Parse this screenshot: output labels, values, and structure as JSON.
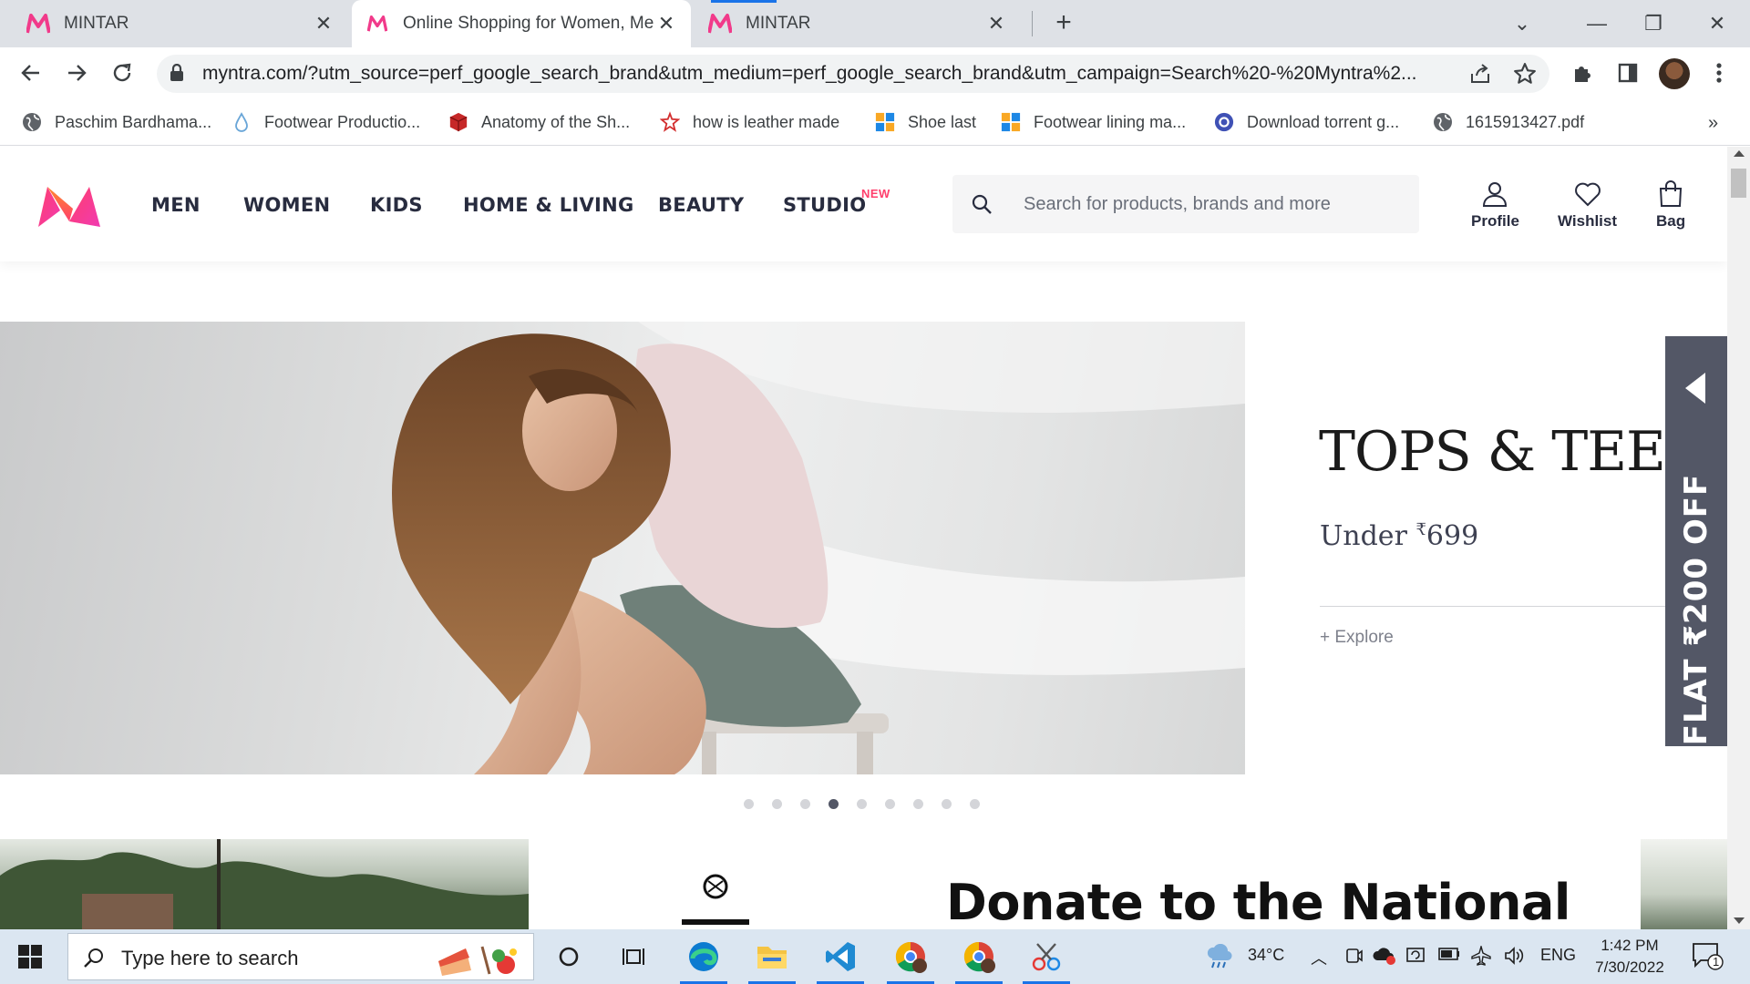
{
  "browser": {
    "tabs": [
      {
        "title": "MINTAR",
        "active": false
      },
      {
        "title": "Online Shopping for Women, Men",
        "active": true
      },
      {
        "title": "MINTAR",
        "active": false
      }
    ],
    "new_tab_label": "+",
    "url": "myntra.com/?utm_source=perf_google_search_brand&utm_medium=perf_google_search_brand&utm_campaign=Search%20-%20Myntra%2...",
    "bookmarks": [
      {
        "label": "Paschim Bardhama...",
        "icon": "globe-icon"
      },
      {
        "label": "Footwear Productio...",
        "icon": "drop-icon"
      },
      {
        "label": "Anatomy of the Sh...",
        "icon": "cube-icon"
      },
      {
        "label": "how is leather made",
        "icon": "star-outline-icon"
      },
      {
        "label": "Shoe last",
        "icon": "grid-icon"
      },
      {
        "label": "Footwear lining ma...",
        "icon": "grid-icon"
      },
      {
        "label": "Download torrent g...",
        "icon": "gear-circle-icon"
      },
      {
        "label": "1615913427.pdf",
        "icon": "globe-icon"
      }
    ],
    "bookmarks_more": "»"
  },
  "site": {
    "nav": [
      "MEN",
      "WOMEN",
      "KIDS",
      "HOME & LIVING",
      "BEAUTY",
      "STUDIO"
    ],
    "nav_badge": "NEW",
    "search_placeholder": "Search for products, brands and more",
    "actions": {
      "profile": "Profile",
      "wishlist": "Wishlist",
      "bag": "Bag"
    },
    "brand_colors": {
      "pink": "#ff3f6c",
      "orange": "#f13ab1",
      "dark": "#282c3f"
    }
  },
  "hero": {
    "title": "TOPS & TEES",
    "subtitle_prefix": "Under ",
    "currency": "₹",
    "price": "699",
    "cta": "+ Explore",
    "side_offer": "FLAT ₹200 OFF",
    "dots_total": 9,
    "active_dot": 4
  },
  "banner2": {
    "headline": "Donate to the National"
  },
  "taskbar": {
    "search_text": "Type here to search",
    "weather": "34°C",
    "language": "ENG",
    "time": "1:42 PM",
    "date": "7/30/2022",
    "notification_count": "1"
  }
}
